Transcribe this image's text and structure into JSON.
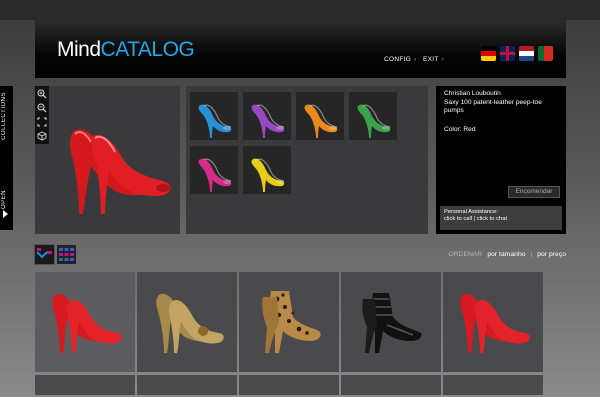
{
  "header": {
    "logo_part1": "Mind",
    "logo_part2": "CATALOG",
    "nav": [
      {
        "label": "CONFIG"
      },
      {
        "label": "EXIT"
      }
    ],
    "languages": [
      "de-flag-icon",
      "uk-flag-icon",
      "nl-flag-icon",
      "pt-flag-icon"
    ]
  },
  "sidebar": {
    "collections_label": "COLLECTIONS",
    "open_label": "OPEN"
  },
  "viewer": {
    "tools": [
      "zoom-in-icon",
      "zoom-out-icon",
      "fit-icon",
      "3d-box-icon"
    ]
  },
  "swatches": {
    "colors": [
      "#2a8fd6",
      "#9a47c2",
      "#e98a1a",
      "#3aa24a",
      "#d42a8a",
      "#e8cc18"
    ]
  },
  "product": {
    "name_line1": "Christian Louboutin",
    "name_line2": "Saxy 100 patent-leather peep-toe pumps",
    "color_label": "Color: Red",
    "order_button": "Encomendar",
    "assist_title": "Personal Assistance:",
    "assist_call": "click to call",
    "assist_sep": "|",
    "assist_chat": "click to chat"
  },
  "sort": {
    "label": "ORDENAR",
    "by_size": "por tamanho",
    "sep": "|",
    "by_price": "por preço"
  },
  "grid": {
    "items": [
      "red-pump",
      "gold-pump",
      "leopard-bootie",
      "black-sandal",
      "red-pump"
    ]
  },
  "colors": {
    "accent": "#27a6e5",
    "nav_arrow": "#6fc04a"
  }
}
